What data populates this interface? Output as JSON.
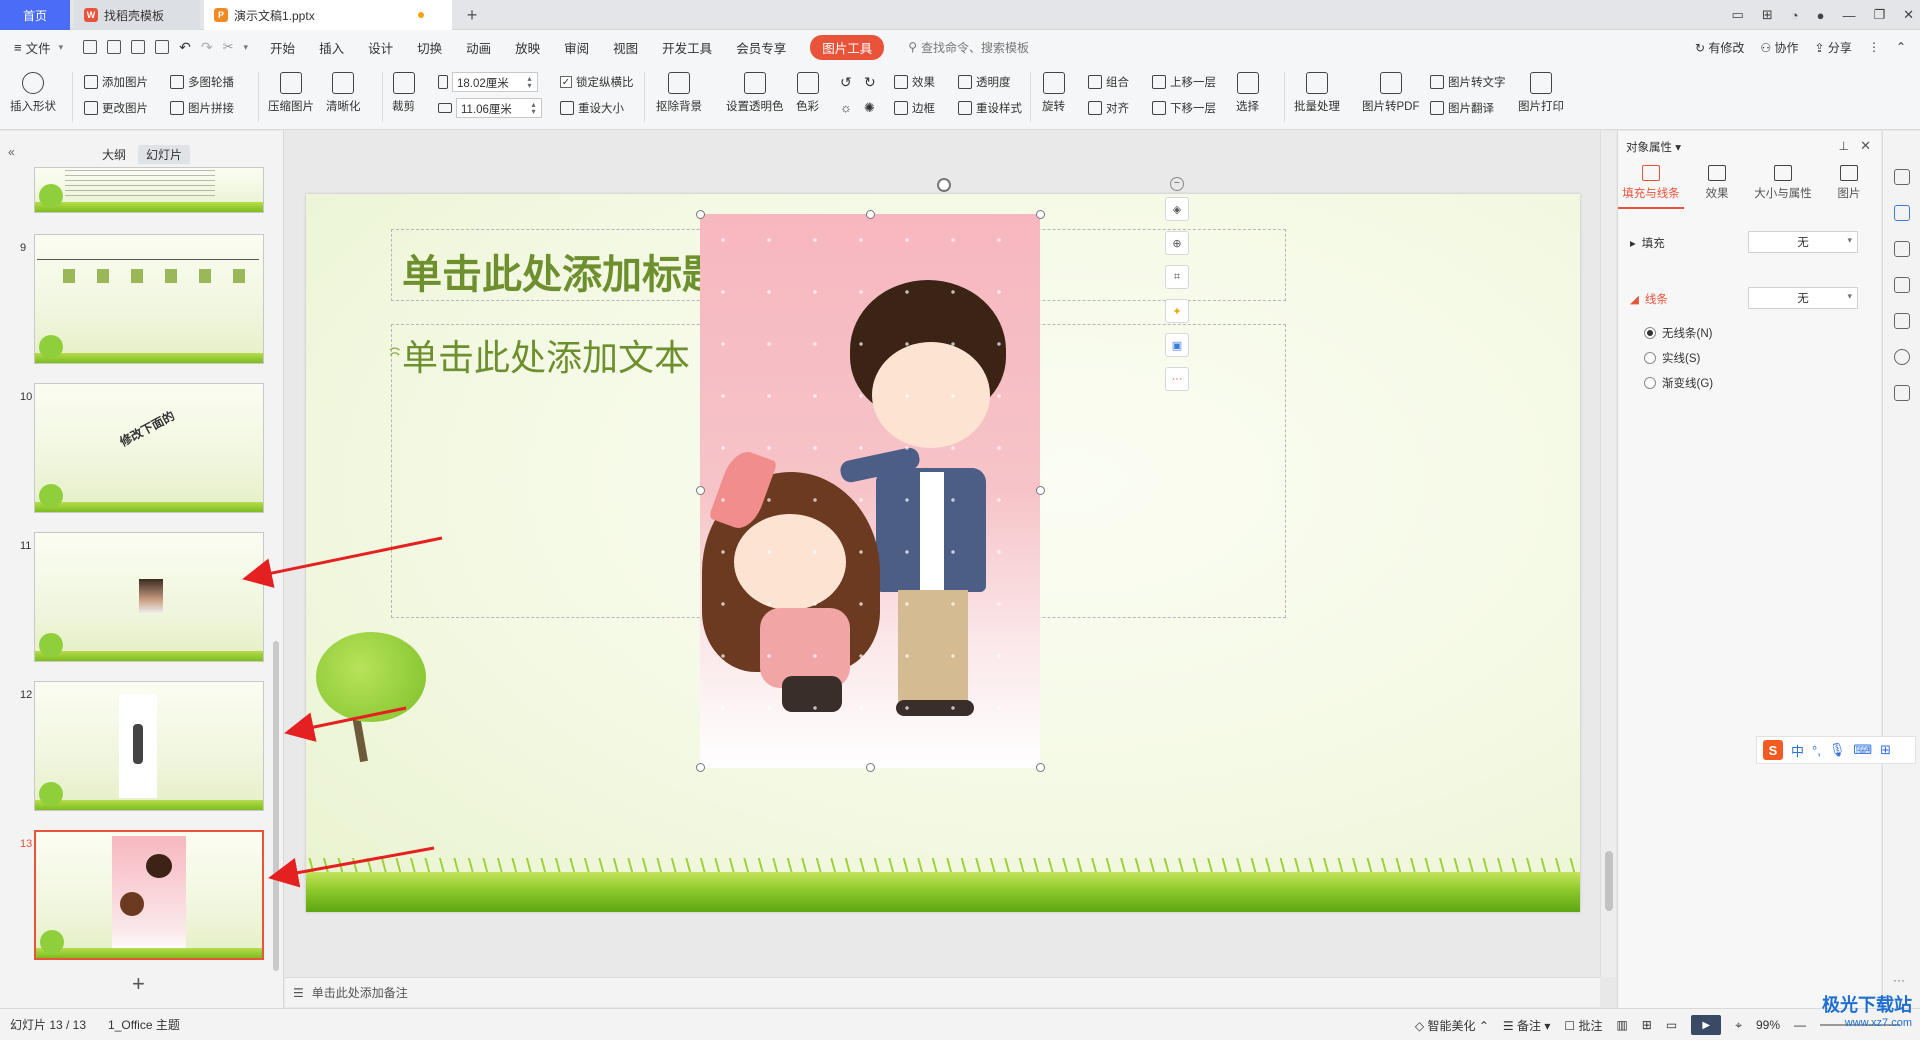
{
  "tabs": {
    "home": "首页",
    "template": "找稻壳模板",
    "document": "演示文稿1.pptx"
  },
  "menu": {
    "file": "文件",
    "items": [
      "开始",
      "插入",
      "设计",
      "切换",
      "动画",
      "放映",
      "审阅",
      "视图",
      "开发工具",
      "会员专享"
    ],
    "active": "图片工具",
    "search": "查找命令、搜索模板",
    "right": [
      "有修改",
      "协作",
      "分享"
    ]
  },
  "ribbon": {
    "insert_shape": "插入形状",
    "add_image": "添加图片",
    "change_image": "更改图片",
    "multi_carousel": "多图轮播",
    "image_collage": "图片拼接",
    "compress": "压缩图片",
    "sharpen": "清晰化",
    "crop": "裁剪",
    "width": "18.02厘米",
    "height": "11.06厘米",
    "lock_ratio": "锁定纵横比",
    "reset_size": "重设大小",
    "remove_bg": "抠除背景",
    "set_transparent": "设置透明色",
    "color": "色彩",
    "effects": "效果",
    "transparency": "透明度",
    "border": "边框",
    "reset_style": "重设样式",
    "rotate": "旋转",
    "group": "组合",
    "align": "对齐",
    "bring_forward": "上移一层",
    "send_backward": "下移一层",
    "select": "选择",
    "batch": "批量处理",
    "to_pdf": "图片转PDF",
    "to_text": "图片转文字",
    "translate": "图片翻译",
    "print": "图片打印"
  },
  "left_panel": {
    "tab_outline": "大纲",
    "tab_slides": "幻灯片",
    "thumbs": [
      {
        "num": "9"
      },
      {
        "num": "10",
        "text": "修改下面的"
      },
      {
        "num": "11"
      },
      {
        "num": "12"
      },
      {
        "num": "13"
      }
    ]
  },
  "slide": {
    "title_placeholder": "单击此处添加标题",
    "body_placeholder": "单击此处添加文本"
  },
  "notes_placeholder": "单击此处添加备注",
  "right_panel": {
    "title": "对象属性",
    "tabs": [
      "填充与线条",
      "效果",
      "大小与属性",
      "图片"
    ],
    "fill_label": "填充",
    "fill_value": "无",
    "line_label": "线条",
    "line_value": "无",
    "options": [
      "无线条(N)",
      "实线(S)",
      "渐变线(G)"
    ]
  },
  "status": {
    "slide_counter": "幻灯片 13 / 13",
    "theme": "1_Office 主题",
    "beautify": "智能美化",
    "notes": "备注",
    "comments": "批注",
    "zoom": "99%"
  },
  "ime": {
    "lang": "中"
  },
  "watermark": {
    "title": "极光下载站",
    "url": "www.xz7.com"
  },
  "colors": {
    "accent": "#e8533a",
    "home_tab": "#4a6cf7",
    "arrow": "#e52020"
  }
}
